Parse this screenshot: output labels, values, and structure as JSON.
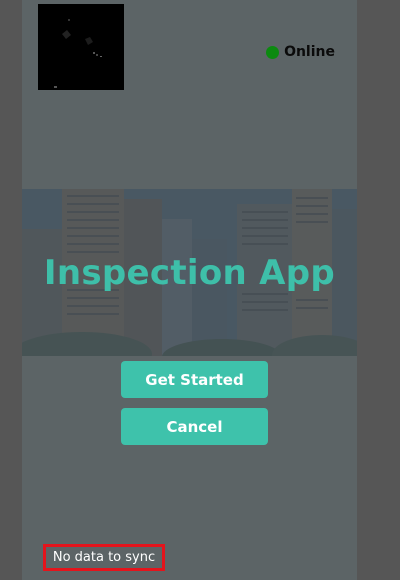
{
  "status": {
    "label": "Online",
    "color": "#0c8a10",
    "icon": "status-dot-icon"
  },
  "hero": {
    "title": "Inspection App",
    "title_color": "#3ebfa9"
  },
  "buttons": {
    "get_started_label": "Get Started",
    "cancel_label": "Cancel",
    "color": "#3ec2ab"
  },
  "footer": {
    "sync_text": "No data to sync",
    "highlight_color": "#e4141c"
  }
}
